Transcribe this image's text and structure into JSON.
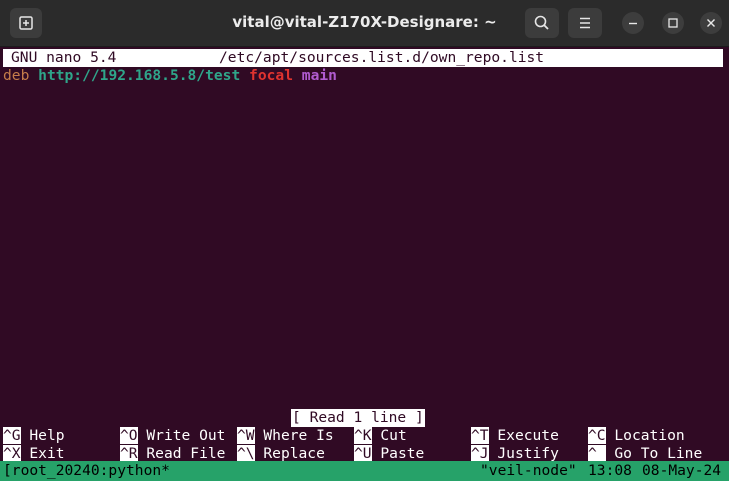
{
  "window": {
    "title": "vital@vital-Z170X-Designare: ~",
    "new_tab_icon": "new-tab-icon",
    "search_icon": "search-icon",
    "menu_icon": "hamburger-menu-icon",
    "minimize": "minimize-icon",
    "maximize": "maximize-icon",
    "close": "close-icon"
  },
  "nano": {
    "version": "GNU nano 5.4",
    "file_path": "/etc/apt/sources.list.d/own_repo.list",
    "content": {
      "keyword": "deb",
      "url": "http://192.168.5.8/test",
      "distribution": "focal",
      "component": "main"
    },
    "status_message": "[ Read 1 line ]",
    "shortcuts": [
      {
        "key": "^G",
        "label": "Help"
      },
      {
        "key": "^O",
        "label": "Write Out"
      },
      {
        "key": "^W",
        "label": "Where Is"
      },
      {
        "key": "^K",
        "label": "Cut"
      },
      {
        "key": "^T",
        "label": "Execute"
      },
      {
        "key": "^C",
        "label": "Location"
      },
      {
        "key": "^X",
        "label": "Exit"
      },
      {
        "key": "^R",
        "label": "Read File"
      },
      {
        "key": "^\\",
        "label": "Replace"
      },
      {
        "key": "^U",
        "label": "Paste"
      },
      {
        "key": "^J",
        "label": "Justify"
      },
      {
        "key": "^_",
        "label": "Go To Line"
      }
    ]
  },
  "tmux": {
    "session_window": "[root_20240:python*",
    "host": "\"veil-node\"",
    "time": "13:08",
    "date": "08-May-24"
  },
  "colors": {
    "terminal_bg": "#300a24",
    "titlebar_bg": "#2b2b2b",
    "tmux_bar": "#26a269",
    "keyword": "#c57d4a",
    "url": "#2fa58a",
    "distribution": "#e0332f",
    "component": "#b15cd0"
  }
}
